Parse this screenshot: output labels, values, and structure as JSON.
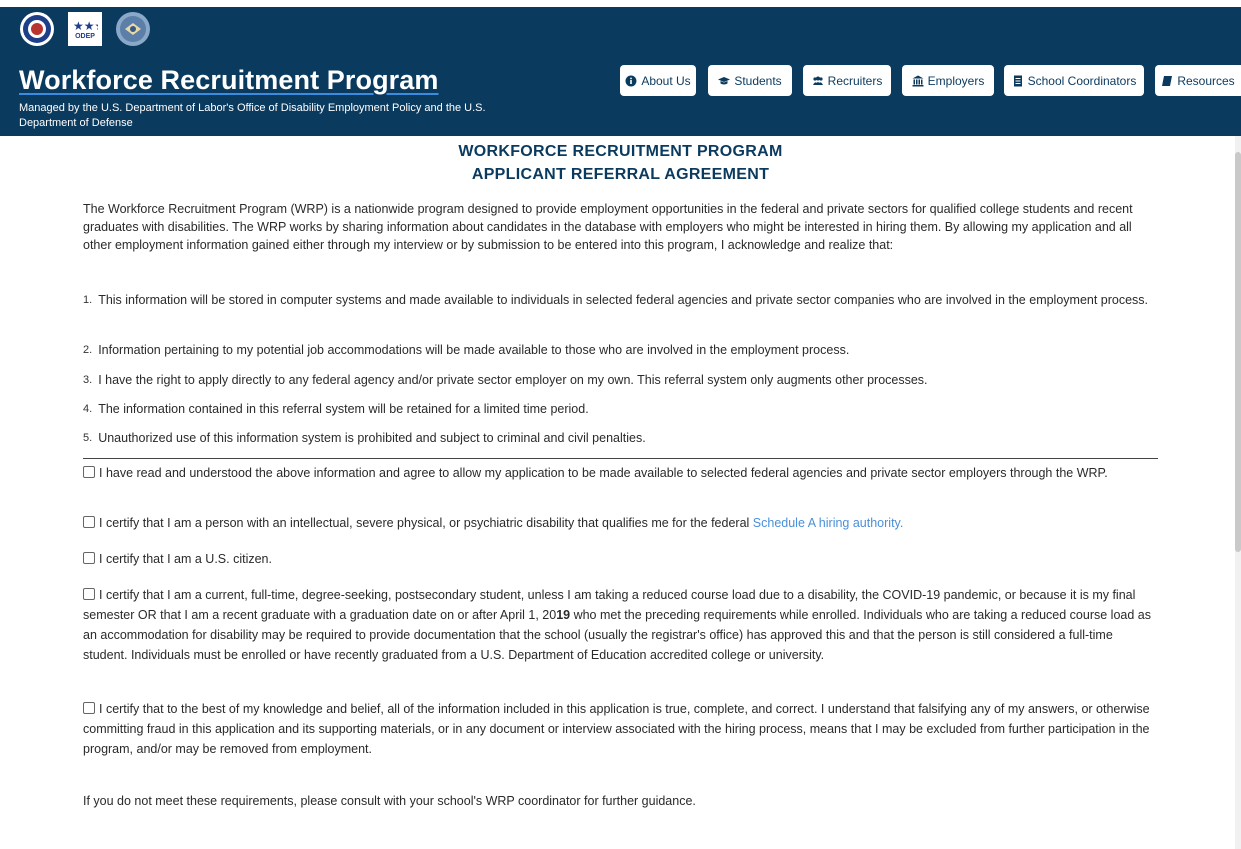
{
  "header": {
    "title": "Workforce Recruitment Program",
    "subtitle": "Managed by the U.S. Department of Labor's Office of Disability Employment Policy and the U.S. Department of Defense",
    "logos": [
      {
        "name": "dol-seal"
      },
      {
        "name": "odep-logo",
        "text": "ODEP"
      },
      {
        "name": "dod-seal"
      }
    ]
  },
  "nav": [
    {
      "label": "About Us",
      "icon": "info-icon"
    },
    {
      "label": "Students",
      "icon": "graduation-cap-icon"
    },
    {
      "label": "Recruiters",
      "icon": "users-icon"
    },
    {
      "label": "Employers",
      "icon": "building-icon"
    },
    {
      "label": "School Coordinators",
      "icon": "document-icon"
    },
    {
      "label": "Resources",
      "icon": "book-icon"
    }
  ],
  "agreement": {
    "heading1": "WORKFORCE RECRUITMENT PROGRAM",
    "heading2": "APPLICANT REFERRAL AGREEMENT",
    "intro": "The Workforce Recruitment Program (WRP) is a nationwide program designed to provide employment opportunities in the federal and private sectors for qualified college students and recent graduates with disabilities. The WRP works by sharing information about candidates in the database with employers who might be interested in hiring them. By allowing my application and all other employment information gained either through my interview or by submission to be entered into this program, I acknowledge and realize that:",
    "items": [
      {
        "num": "1.",
        "text": "This information will be stored in computer systems and made available to individuals in selected federal agencies and private sector companies who are involved in the employment process."
      },
      {
        "num": "2.",
        "text": "Information pertaining to my potential job accommodations will be made available to those who are involved in the employment process."
      },
      {
        "num": "3.",
        "text": "I have the right to apply directly to any federal agency and/or private sector employer on my own. This referral system only augments other processes."
      },
      {
        "num": "4.",
        "text": "The information contained in this referral system will be retained for a limited time period."
      },
      {
        "num": "5.",
        "text": "Unauthorized use of this information system is prohibited and subject to criminal and civil penalties."
      }
    ],
    "checkboxes": [
      {
        "text": "I have read and understood the above information and agree to allow my application to be made available to selected federal agencies and private sector employers through the WRP."
      },
      {
        "text": "I certify that I am a person with an intellectual, severe physical, or psychiatric disability that qualifies me for the federal ",
        "link": "Schedule A hiring authority."
      },
      {
        "text": "I certify that I am a U.S. citizen."
      },
      {
        "text_before_year": "I certify that I am a current, full-time, degree-seeking, postsecondary student, unless I am taking a reduced course load due to a disability, the COVID-19 pandemic, or because it is my final semester OR that I am a recent graduate with a graduation date on or after April 1, 20",
        "year_suffix": "19",
        "text_after_year": " who met the preceding requirements while enrolled. Individuals who are taking a reduced course load as an accommodation for disability may be required to provide documentation that the school (usually the registrar's office) has approved this and that the person is still considered a full-time student. Individuals must be enrolled or have recently graduated from a U.S. Department of Education accredited college or university."
      },
      {
        "text": "I certify that to the best of my knowledge and belief, all of the information included in this application is true, complete, and correct. I understand that falsifying any of my answers, or otherwise committing fraud in this application and its supporting materials, or in any document or interview associated with the hiring process, means that I may be excluded from further participation in the program, and/or may be removed from employment."
      }
    ],
    "footer": "If you do not meet these requirements, please consult with your school's WRP coordinator for further guidance."
  }
}
